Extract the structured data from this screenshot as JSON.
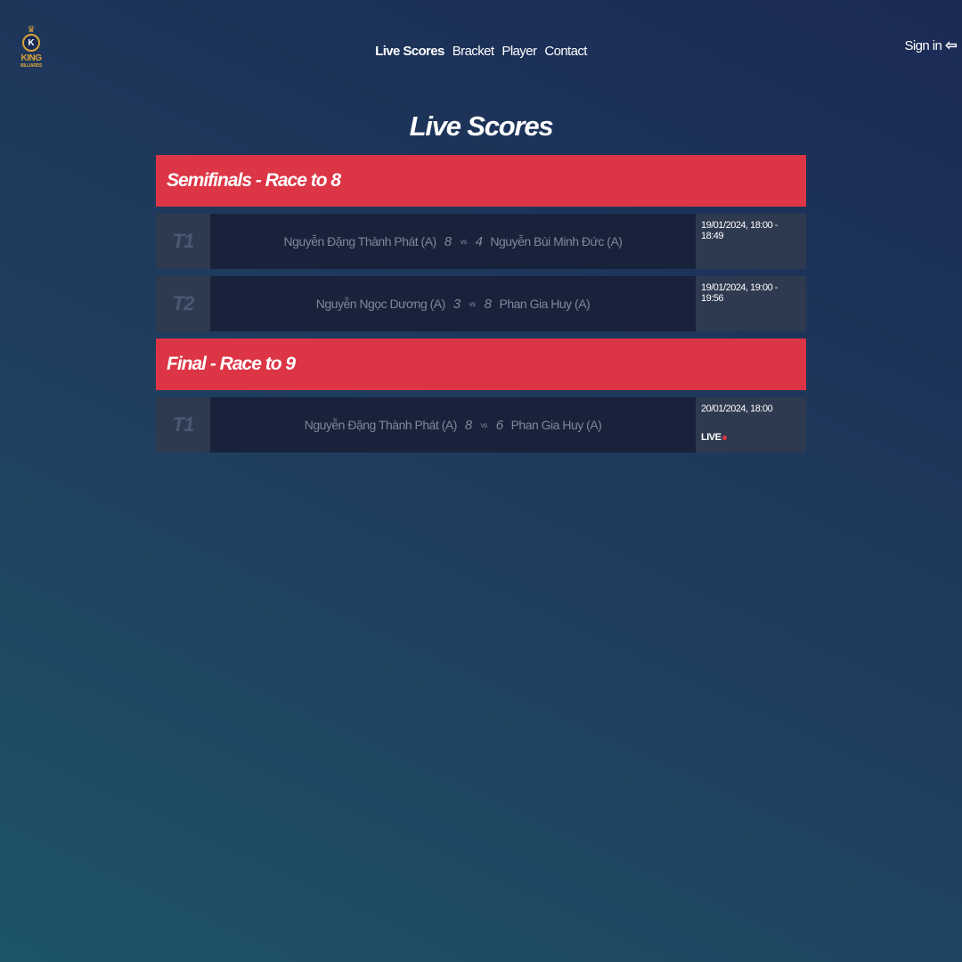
{
  "logo": {
    "line1": "KING",
    "line2": "BILLIARDS",
    "badge": "K",
    "icon": "crown-icon"
  },
  "nav": {
    "items": [
      {
        "label": "Live Scores",
        "active": true
      },
      {
        "label": "Bracket",
        "active": false
      },
      {
        "label": "Player",
        "active": false
      },
      {
        "label": "Contact",
        "active": false
      }
    ]
  },
  "signin": {
    "label": "Sign in",
    "icon": "sign-in-icon"
  },
  "page": {
    "title": "Live Scores"
  },
  "rounds": [
    {
      "title": "Semifinals - Race to 8",
      "matches": [
        {
          "table": "T1",
          "player1": "Nguyễn Đặng Thành Phát (A)",
          "score1": "8",
          "vs": "vs",
          "score2": "4",
          "player2": "Nguyễn Bùi Minh Đức (A)",
          "time": "19/01/2024, 18:00 - 18:49",
          "status": ""
        },
        {
          "table": "T2",
          "player1": "Nguyễn Ngọc Dương (A)",
          "score1": "3",
          "vs": "vs",
          "score2": "8",
          "player2": "Phan Gia Huy (A)",
          "time": "19/01/2024, 19:00 - 19:56",
          "status": ""
        }
      ]
    },
    {
      "title": "Final - Race to 9",
      "matches": [
        {
          "table": "T1",
          "player1": "Nguyễn Đặng Thành Phát (A)",
          "score1": "8",
          "vs": "vs",
          "score2": "6",
          "player2": "Phan Gia Huy (A)",
          "time": "20/01/2024, 18:00",
          "status": "LIVE"
        }
      ]
    }
  ],
  "colors": {
    "accent": "#dc3545",
    "card_dark": "#19223b",
    "card_mid": "#2e3a50"
  }
}
